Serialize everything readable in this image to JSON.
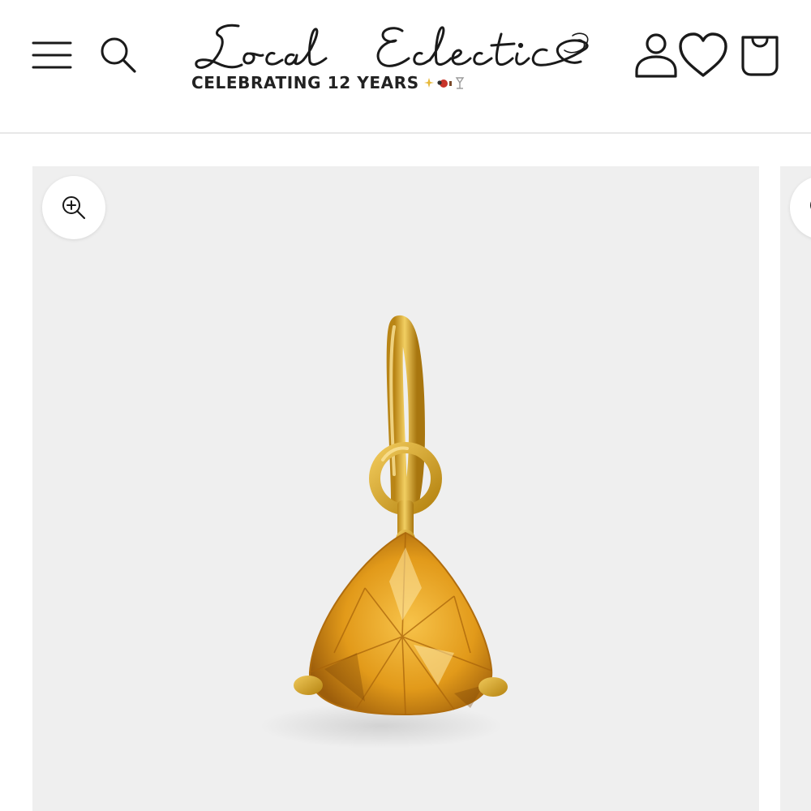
{
  "header": {
    "menu_icon": "hamburger-menu-icon",
    "search_icon": "search-icon",
    "logo_text": "Local Eclectic",
    "tagline": "CELEBRATING 12 YEARS",
    "account_icon": "account-icon",
    "wishlist_icon": "heart-icon",
    "cart_icon": "shopping-bag-icon"
  },
  "gallery": {
    "zoom_icon": "zoom-in-icon",
    "main_image": "gold citrine trillion charm pendant"
  },
  "colors": {
    "background": "#ffffff",
    "header_border": "#e8e8e8",
    "gallery_bg": "#efefef",
    "icon_stroke": "#1a1a1a",
    "gold": "#d9a62a",
    "citrine": "#e39a1c"
  }
}
